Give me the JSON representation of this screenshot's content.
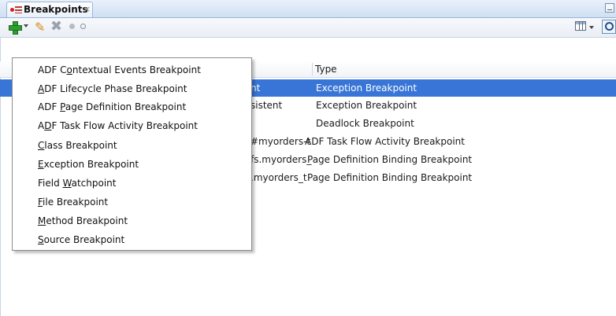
{
  "tab": {
    "title": "Breakpoints",
    "close": "×"
  },
  "table": {
    "header_type": "Type",
    "rows": [
      {
        "name": "nt",
        "type": "Exception Breakpoint",
        "selected": true
      },
      {
        "name": "sistent",
        "type": "Exception Breakpoint"
      },
      {
        "name": "",
        "type": "Deadlock Breakpoint"
      },
      {
        "name": "#myorders-t",
        "type": "ADF Task Flow Activity Breakpoint"
      },
      {
        "name": "fs.myorders_",
        "type": "Page Definition Binding Breakpoint"
      },
      {
        "name": ".myorders_t",
        "type": "Page Definition Binding Breakpoint"
      }
    ]
  },
  "menu": {
    "items": [
      {
        "pre": "ADF C",
        "u": "o",
        "post": "ntextual Events Breakpoint"
      },
      {
        "pre": "",
        "u": "A",
        "post": "DF Lifecycle Phase Breakpoint"
      },
      {
        "pre": "ADF ",
        "u": "P",
        "post": "age Definition Breakpoint"
      },
      {
        "pre": "A",
        "u": "D",
        "post": "F Task Flow Activity Breakpoint"
      },
      {
        "pre": "",
        "u": "C",
        "post": "lass Breakpoint"
      },
      {
        "pre": "",
        "u": "E",
        "post": "xception Breakpoint"
      },
      {
        "pre": "Field ",
        "u": "W",
        "post": "atchpoint"
      },
      {
        "pre": "",
        "u": "F",
        "post": "ile Breakpoint"
      },
      {
        "pre": "",
        "u": "M",
        "post": "ethod Breakpoint"
      },
      {
        "pre": "",
        "u": "S",
        "post": "ource Breakpoint"
      }
    ]
  },
  "colors": {
    "selection": "#3875d7",
    "tabstrip": "#cfdff3"
  }
}
